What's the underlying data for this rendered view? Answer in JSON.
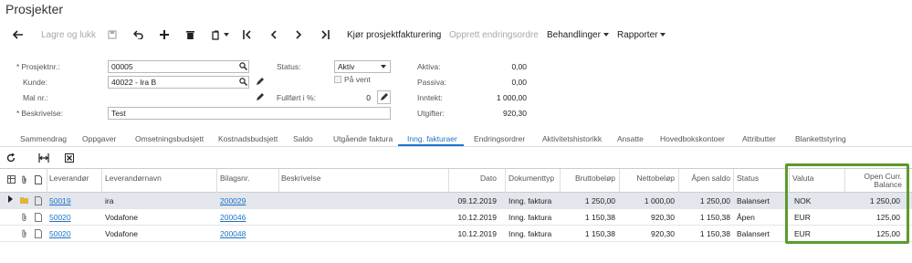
{
  "page_title": "Prosjekter",
  "toolbar": {
    "save_close": "Lagre og lukk",
    "run_billing": "Kjør prosjektfakturering",
    "create_change_order": "Opprett endringsordre",
    "actions": "Behandlinger",
    "reports": "Rapporter"
  },
  "form": {
    "project_no_label": "Prosjektnr.:",
    "project_no": "00005",
    "customer_label": "Kunde:",
    "customer": "40022 - Ira B",
    "template_label": "Mal nr.:",
    "template": "",
    "description_label": "Beskrivelse:",
    "description": "Test",
    "status_label": "Status:",
    "status": "Aktiv",
    "on_hold_label": "På vent",
    "completed_label": "Fullført i %:",
    "completed": "0",
    "assets_label": "Aktiva:",
    "assets": "0,00",
    "liabilities_label": "Passiva:",
    "liabilities": "0,00",
    "income_label": "Inntekt:",
    "income": "1 000,00",
    "expenses_label": "Utgifter:",
    "expenses": "920,30"
  },
  "tabs": [
    "Sammendrag",
    "Oppgaver",
    "Omsetningsbudsjett",
    "Kostnadsbudsjett",
    "Saldo",
    "Utgående faktura",
    "Inng. fakturaer",
    "Endringsordrer",
    "Aktivitetshistorikk",
    "Ansatte",
    "Hovedbokskontoer",
    "Attributter",
    "Blankettstyring"
  ],
  "active_tab": "Inng. fakturaer",
  "grid": {
    "headers": {
      "vendor": "Leverandør",
      "vendor_name": "Leverandørnavn",
      "doc_no": "Bilagsnr.",
      "description": "Beskrivelse",
      "date": "Dato",
      "doc_type": "Dokumenttyp",
      "gross": "Bruttobeløp",
      "net": "Nettobeløp",
      "open_balance": "Åpen saldo",
      "status": "Status",
      "currency": "Valuta",
      "open_curr_1": "Open Curr.",
      "open_curr_2": "Balance"
    },
    "rows": [
      {
        "vendor": "50019",
        "vendor_name": "ira",
        "doc_no": "200029",
        "description": "",
        "date": "09.12.2019",
        "doc_type": "Inng. faktura",
        "gross": "1 250,00",
        "net": "1 000,00",
        "open_balance": "1 250,00",
        "status": "Balansert",
        "currency": "NOK",
        "open_curr": "1 250,00"
      },
      {
        "vendor": "50020",
        "vendor_name": "Vodafone",
        "doc_no": "200046",
        "description": "",
        "date": "10.12.2019",
        "doc_type": "Inng. faktura",
        "gross": "1 150,38",
        "net": "920,30",
        "open_balance": "1 150,38",
        "status": "Åpen",
        "currency": "EUR",
        "open_curr": "125,00"
      },
      {
        "vendor": "50020",
        "vendor_name": "Vodafone",
        "doc_no": "200048",
        "description": "",
        "date": "10.12.2019",
        "doc_type": "Inng. faktura",
        "gross": "1 150,38",
        "net": "920,30",
        "open_balance": "1 150,38",
        "status": "Balansert",
        "currency": "EUR",
        "open_curr": "125,00"
      }
    ]
  },
  "colors": {
    "accent": "#1f73c9",
    "highlight": "#5c9a2c",
    "selected_row": "#e3e6ec"
  }
}
